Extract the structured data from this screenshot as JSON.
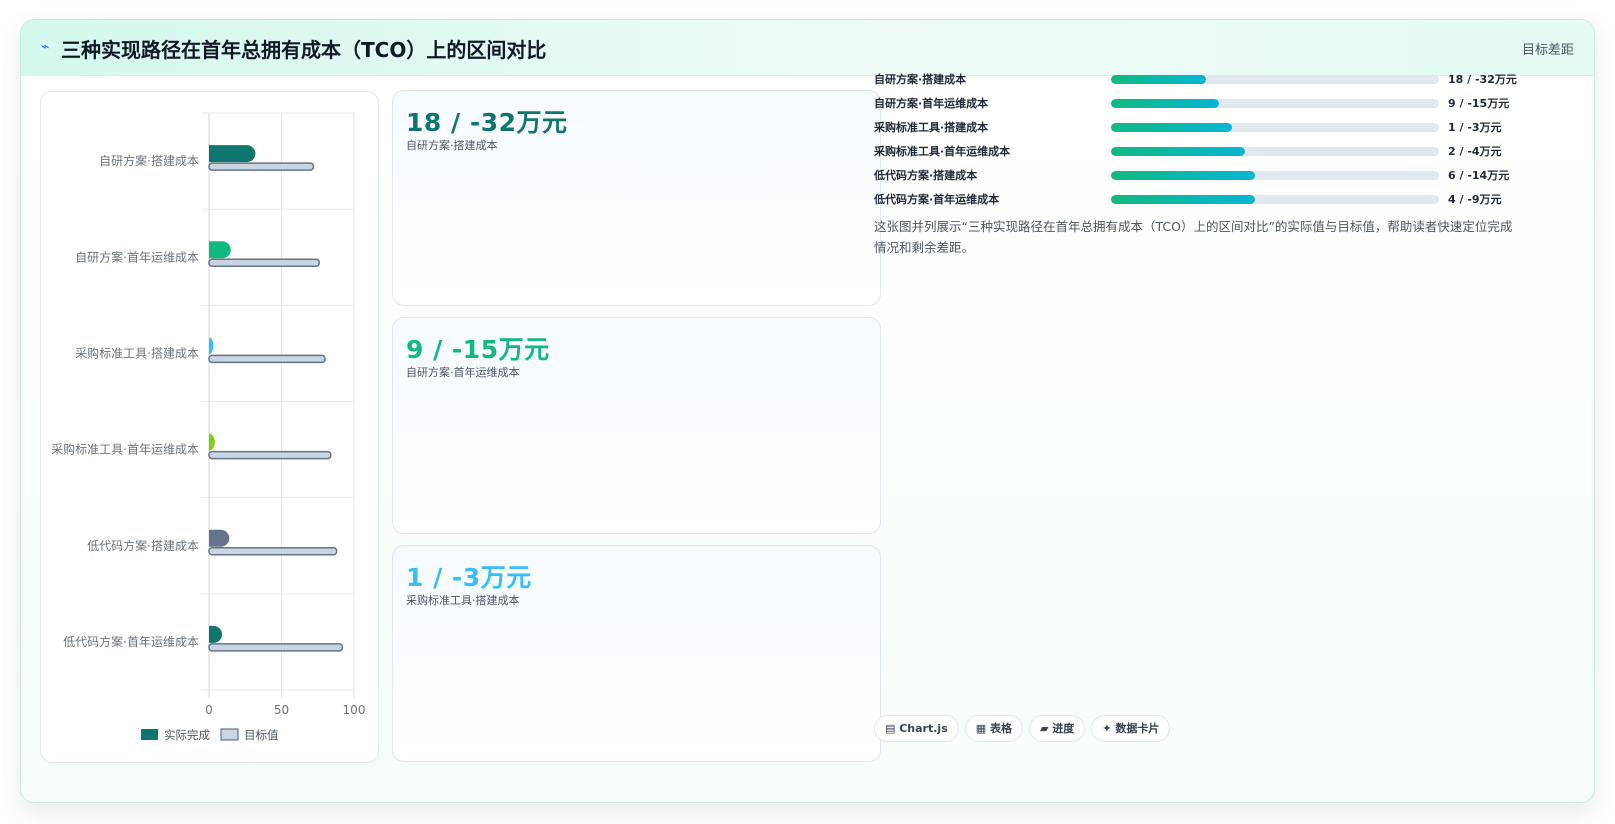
{
  "header": {
    "icon": "bolt-icon",
    "title": "三种实现路径在首年总拥有成本（TCO）上的区间对比",
    "badge": "目标差距"
  },
  "chart_data": {
    "type": "bar",
    "orientation": "horizontal",
    "categories": [
      "自研方案·搭建成本",
      "自研方案·首年运维成本",
      "采购标准工具·搭建成本",
      "采购标准工具·首年运维成本",
      "低代码方案·搭建成本",
      "低代码方案·首年运维成本"
    ],
    "series": [
      {
        "name": "实际完成",
        "values": [
          32,
          15,
          3,
          4,
          14,
          9
        ],
        "colors": [
          "#0f766e",
          "#10b981",
          "#38bdf8",
          "#84cc16",
          "#64748b",
          "#0f766e"
        ]
      },
      {
        "name": "目标值",
        "values": [
          72,
          76,
          80,
          84,
          88,
          92
        ],
        "color": "#cbd5e1"
      }
    ],
    "xlim": [
      0,
      100
    ],
    "xticks": [
      "0",
      "50",
      "100"
    ],
    "grid": true,
    "legend_position": "bottom"
  },
  "kpis": [
    {
      "value": "18 / -32万元",
      "label": "自研方案·搭建成本",
      "color": "#0f766e"
    },
    {
      "value": "9 / -15万元",
      "label": "自研方案·首年运维成本",
      "color": "#10b981"
    },
    {
      "value": "1 / -3万元",
      "label": "采购标准工具·搭建成本",
      "color": "#38bdf8"
    }
  ],
  "progress": [
    {
      "label": "自研方案·搭建成本",
      "value": "18 / -32万元",
      "fill": 0.29
    },
    {
      "label": "自研方案·首年运维成本",
      "value": "9 / -15万元",
      "fill": 0.33
    },
    {
      "label": "采购标准工具·搭建成本",
      "value": "1 / -3万元",
      "fill": 0.37
    },
    {
      "label": "采购标准工具·首年运维成本",
      "value": "2 / -4万元",
      "fill": 0.41
    },
    {
      "label": "低代码方案·搭建成本",
      "value": "6 / -14万元",
      "fill": 0.44
    },
    {
      "label": "低代码方案·首年运维成本",
      "value": "4 / -9万元",
      "fill": 0.44
    }
  ],
  "description": "这张图并列展示“三种实现路径在首年总拥有成本（TCO）上的区间对比”的实际值与目标值，帮助读者快速定位完成情况和剩余差距。",
  "chips": [
    {
      "label": "Chart.js",
      "icon": "chart-icon"
    },
    {
      "label": "表格",
      "icon": "table-icon"
    },
    {
      "label": "进度",
      "icon": "progress-icon"
    },
    {
      "label": "数据卡片",
      "icon": "sparkle-icon"
    }
  ]
}
